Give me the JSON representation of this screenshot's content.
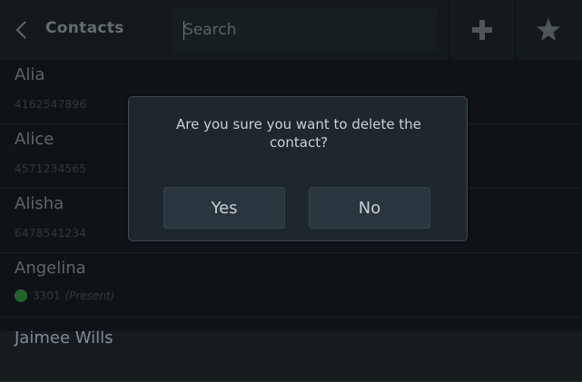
{
  "header": {
    "back_icon": "chevron-left-icon",
    "title": "Contacts",
    "search_placeholder": "Search",
    "add_icon": "plus-icon",
    "favorites_icon": "star-icon"
  },
  "contacts": [
    {
      "name": "Alia",
      "number": "4162547896"
    },
    {
      "name": "Alice",
      "number": "4571234565"
    },
    {
      "name": "Alisha",
      "number": "6478541234"
    },
    {
      "name": "Angelina",
      "number": "3301",
      "status": "(Present)",
      "presence_color": "#2e8b3a"
    },
    {
      "name": "Jaimee Wills"
    }
  ],
  "dialog": {
    "message": "Are you sure you want to delete the contact?",
    "yes_label": "Yes",
    "no_label": "No"
  },
  "colors": {
    "background": "#151b1f",
    "header": "#1b2328",
    "dialog": "#1e272c",
    "presence_green": "#2e8b3a"
  }
}
